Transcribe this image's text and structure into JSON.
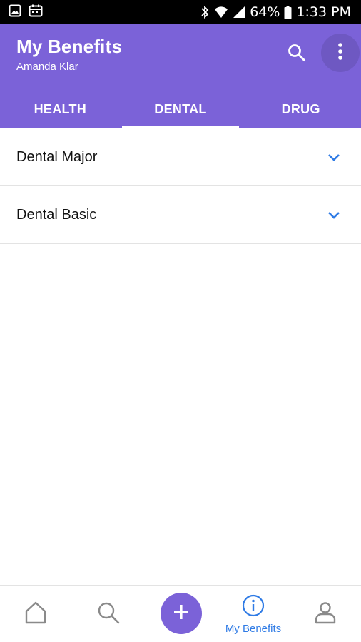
{
  "status_bar": {
    "battery": "64%",
    "time": "1:33 PM",
    "icons": [
      "gallery-icon",
      "calendar-icon",
      "bluetooth-icon",
      "wifi-icon",
      "signal-icon",
      "battery-icon"
    ]
  },
  "header": {
    "title": "My Benefits",
    "subtitle": "Amanda Klar",
    "actions": [
      "search-icon",
      "more-vert-icon"
    ],
    "color": "#7b62d8"
  },
  "tabs": [
    {
      "label": "HEALTH",
      "active": false
    },
    {
      "label": "DENTAL",
      "active": true
    },
    {
      "label": "DRUG",
      "active": false
    }
  ],
  "benefits": [
    {
      "label": "Dental Major",
      "icon": "chevron-down-icon"
    },
    {
      "label": "Dental Basic",
      "icon": "chevron-down-icon"
    }
  ],
  "bottom_nav": {
    "items": [
      {
        "icon": "home-icon",
        "label": ""
      },
      {
        "icon": "search-icon",
        "label": ""
      },
      {
        "icon": "add-icon",
        "label": ""
      },
      {
        "icon": "info-icon",
        "label": "My Benefits",
        "active": true
      },
      {
        "icon": "profile-icon",
        "label": ""
      }
    ],
    "active_color": "#2f7be5"
  }
}
